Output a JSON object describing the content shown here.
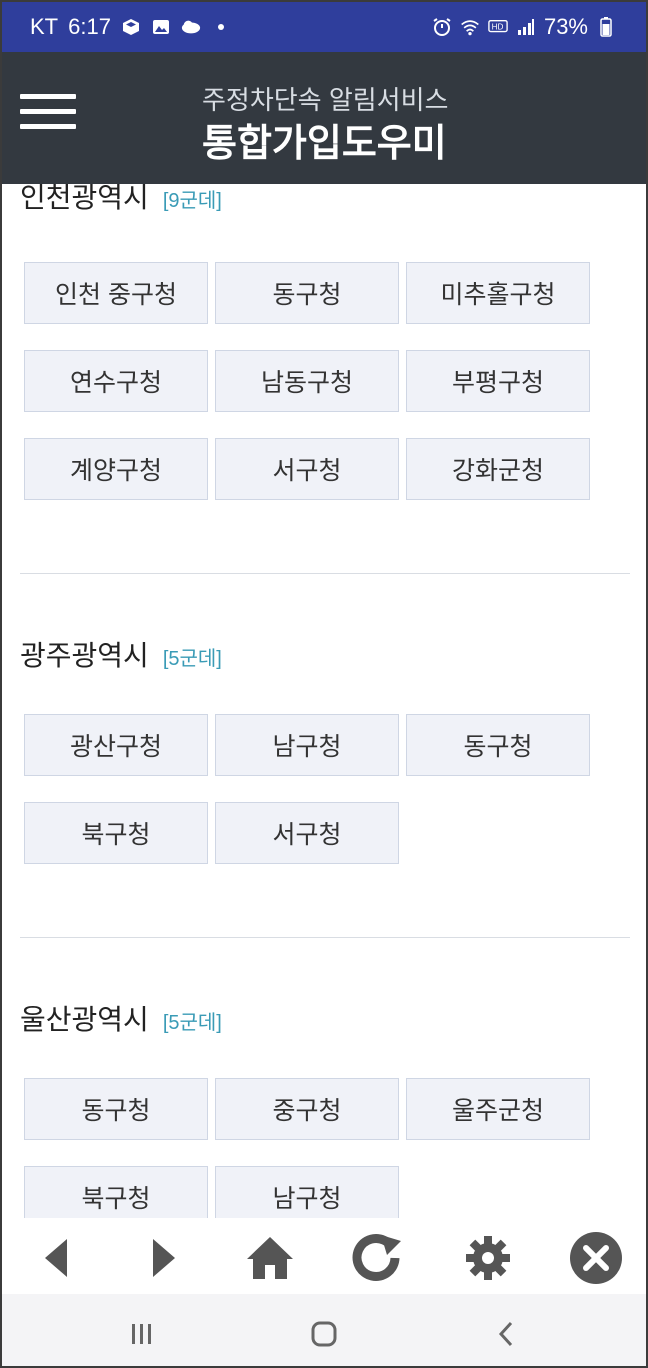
{
  "status_bar": {
    "carrier": "KT",
    "time": "6:17",
    "battery": "73%",
    "icons_left": [
      "box-icon",
      "image-icon",
      "cloud-icon",
      "dot-icon"
    ],
    "icons_right": [
      "alarm-icon",
      "wifi-icon",
      "hd-icon",
      "signal-icon",
      "battery-icon"
    ]
  },
  "app_bar": {
    "subtitle": "주정차단속 알림서비스",
    "title": "통합가입도우미",
    "menu_icon": "hamburger-menu-icon"
  },
  "regions": [
    {
      "name": "인천광역시",
      "count": "[9군데]",
      "offices": [
        "인천 중구청",
        "동구청",
        "미추홀구청",
        "연수구청",
        "남동구청",
        "부평구청",
        "계양구청",
        "서구청",
        "강화군청"
      ]
    },
    {
      "name": "광주광역시",
      "count": "[5군데]",
      "offices": [
        "광산구청",
        "남구청",
        "동구청",
        "북구청",
        "서구청"
      ]
    },
    {
      "name": "울산광역시",
      "count": "[5군데]",
      "offices": [
        "동구청",
        "중구청",
        "울주군청",
        "북구청",
        "남구청"
      ]
    }
  ],
  "toolbar": {
    "items": [
      "back-arrow-icon",
      "forward-arrow-icon",
      "home-icon",
      "refresh-icon",
      "settings-gear-icon",
      "close-circle-icon"
    ]
  },
  "nav_bar": {
    "items": [
      "recent-apps-icon",
      "home-button-icon",
      "back-chevron-icon"
    ]
  },
  "colors": {
    "status_bar_bg": "#2f3e9c",
    "app_bar_bg": "#333940",
    "button_bg": "#f0f2f8",
    "count_text": "#3a9bb6"
  }
}
